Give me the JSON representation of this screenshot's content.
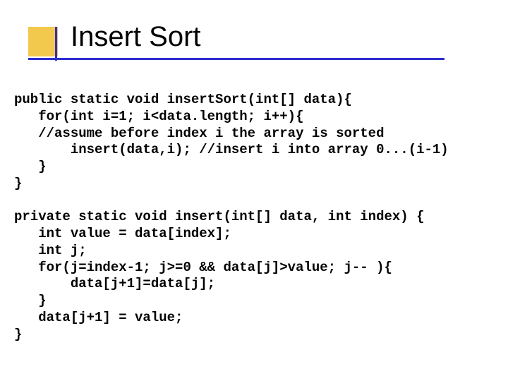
{
  "title": "Insert Sort",
  "code": {
    "l01": "public static void insertSort(int[] data){",
    "l02": "   for(int i=1; i<data.length; i++){",
    "l03": "   //assume before index i the array is sorted",
    "l04": "       insert(data,i); //insert i into array 0...(i-1)",
    "l05": "   }",
    "l06": "}",
    "l07": "",
    "l08": "private static void insert(int[] data, int index) {",
    "l09": "   int value = data[index];",
    "l10": "   int j;",
    "l11": "   for(j=index-1; j>=0 && data[j]>value; j-- ){",
    "l12": "       data[j+1]=data[j];",
    "l13": "   }",
    "l14": "   data[j+1] = value;",
    "l15": "}"
  }
}
